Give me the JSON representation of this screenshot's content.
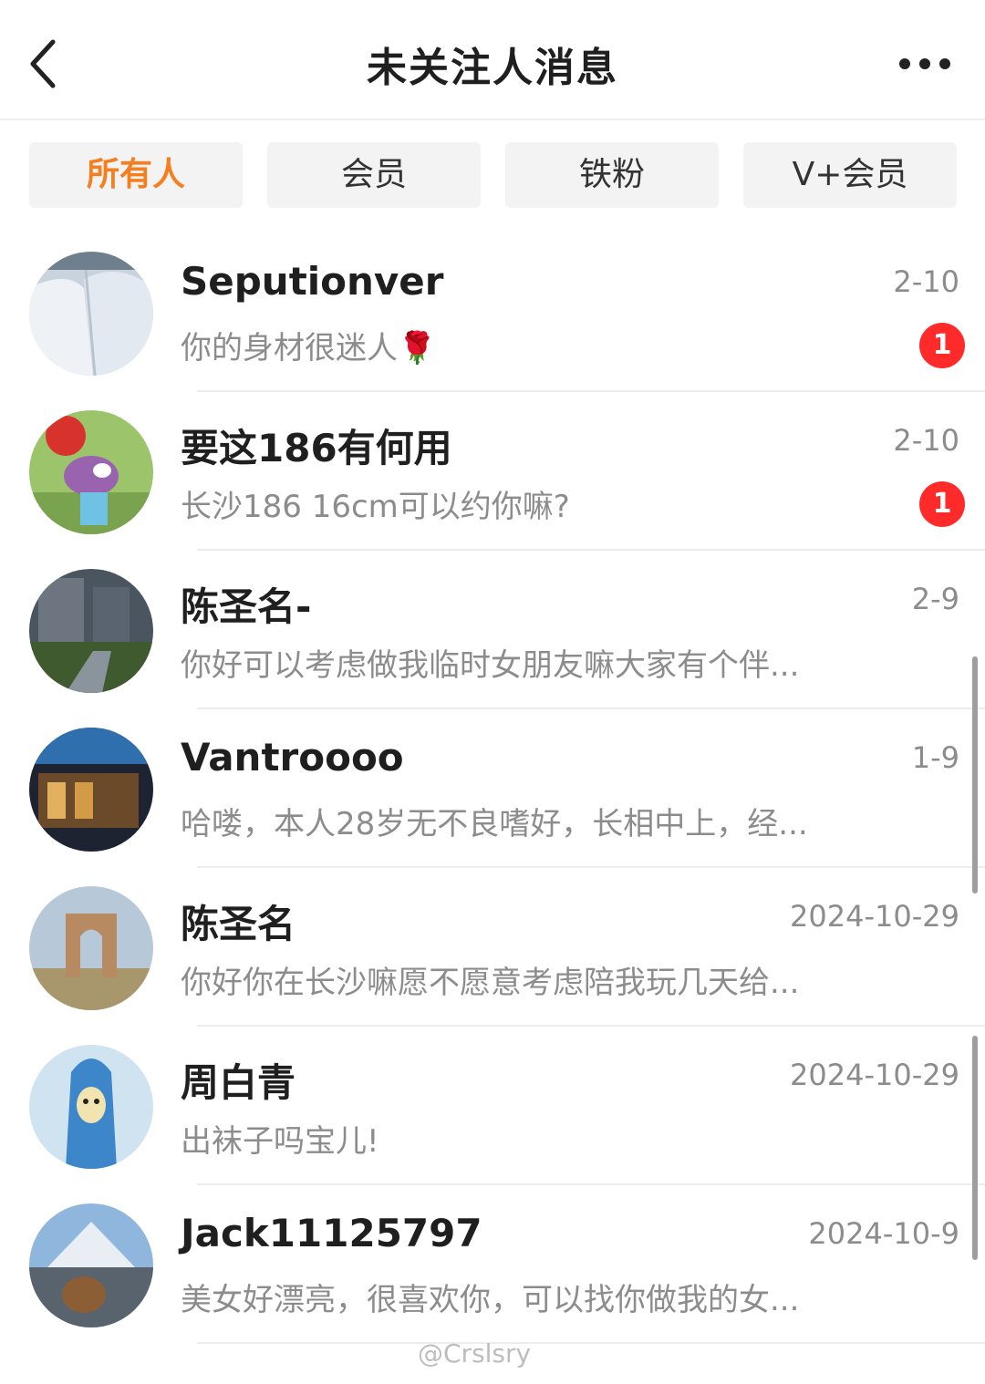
{
  "header": {
    "title": "未关注人消息",
    "back_icon": "chevron-left-icon",
    "more_icon": "more-dots-icon"
  },
  "tabs": [
    {
      "label": "所有人",
      "active": true
    },
    {
      "label": "会员",
      "active": false
    },
    {
      "label": "铁粉",
      "active": false
    },
    {
      "label": "V+会员",
      "active": false
    }
  ],
  "messages": [
    {
      "name": "Seputionver",
      "time": "2-10",
      "preview": "你的身材很迷人🌹",
      "unread": "1"
    },
    {
      "name": "要这186有何用",
      "time": "2-10",
      "preview": "长沙186 16cm可以约你嘛?",
      "unread": "1"
    },
    {
      "name": "陈圣名-",
      "time": "2-9",
      "preview": "你好可以考虑做我临时女朋友嘛大家有个伴...",
      "unread": ""
    },
    {
      "name": "Vantroooo",
      "time": "1-9",
      "preview": "哈喽，本人28岁无不良嗜好，长相中上，经...",
      "unread": ""
    },
    {
      "name": "陈圣名",
      "time": "2024-10-29",
      "preview": "你好你在长沙嘛愿不愿意考虑陪我玩几天给...",
      "unread": ""
    },
    {
      "name": "周白青",
      "time": "2024-10-29",
      "preview": "出袜子吗宝儿!",
      "unread": ""
    },
    {
      "name": "Jack11125797",
      "time": "2024-10-9",
      "preview": "美女好漂亮，很喜欢你，可以找你做我的女...",
      "unread": ""
    }
  ],
  "watermark": "@Crslsry",
  "colors": {
    "accent": "#f57e1f",
    "badge": "#ff2b2b",
    "secondary_text": "#8c8c8c"
  }
}
